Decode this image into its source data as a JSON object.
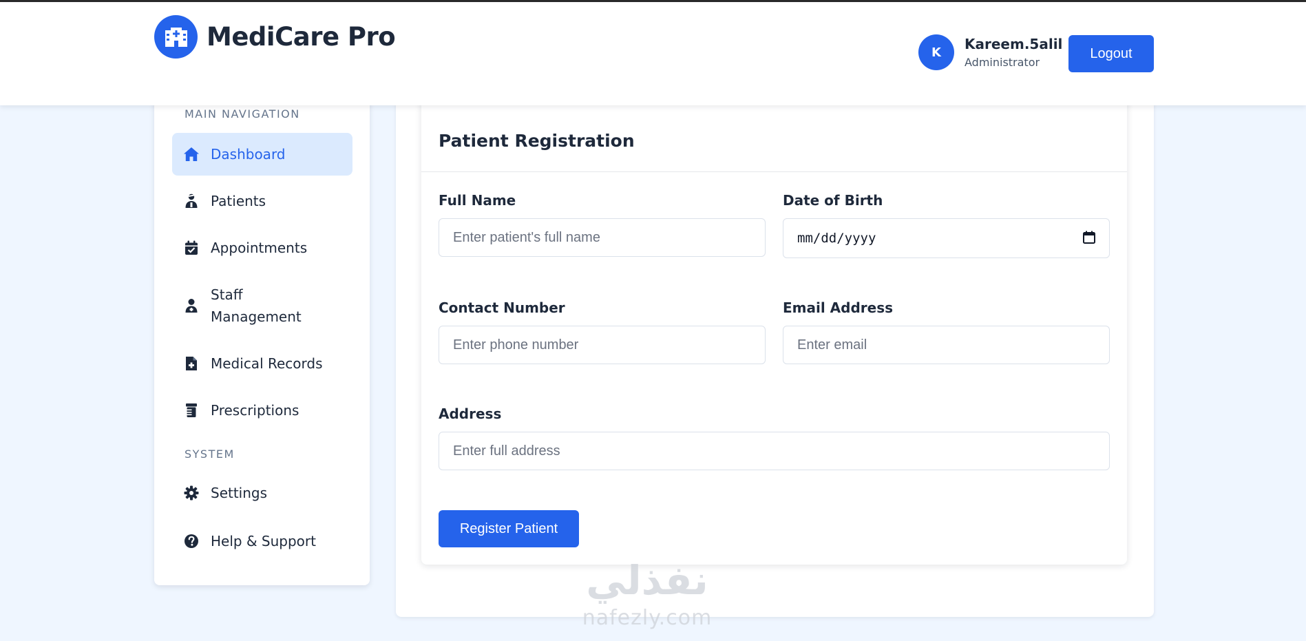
{
  "header": {
    "app_name": "MediCare Pro",
    "user": {
      "initial": "K",
      "name": "Kareem.5alil",
      "role": "Administrator"
    },
    "logout_label": "Logout"
  },
  "sidebar": {
    "sections": [
      {
        "title": "MAIN NAVIGATION"
      },
      {
        "title": "SYSTEM"
      }
    ],
    "items": [
      {
        "label": "Dashboard",
        "icon": "home-icon",
        "active": true
      },
      {
        "label": "Patients",
        "icon": "user-injured-icon"
      },
      {
        "label": "Appointments",
        "icon": "calendar-check-icon"
      },
      {
        "label": "Staff\nManagement",
        "icon": "user-doctor-icon"
      },
      {
        "label": "Medical Records",
        "icon": "file-medical-icon"
      },
      {
        "label": "Prescriptions",
        "icon": "prescription-bottle-icon"
      },
      {
        "label": "Settings",
        "icon": "gear-icon"
      },
      {
        "label": "Help & Support",
        "icon": "question-circle-icon"
      }
    ]
  },
  "form": {
    "title": "Patient Registration",
    "fields": {
      "full_name": {
        "label": "Full Name",
        "placeholder": "Enter patient's full name",
        "value": ""
      },
      "dob": {
        "label": "Date of Birth",
        "placeholder": "mm/dd/yyyy"
      },
      "contact": {
        "label": "Contact Number",
        "placeholder": "Enter phone number",
        "value": ""
      },
      "email": {
        "label": "Email Address",
        "placeholder": "Enter email",
        "value": ""
      },
      "address": {
        "label": "Address",
        "placeholder": "Enter full address",
        "value": ""
      }
    },
    "submit_label": "Register Patient"
  },
  "watermark": {
    "arabic": "نفذلي",
    "latin": "nafezly.com"
  },
  "colors": {
    "primary": "#2563eb",
    "active_bg": "#dbeafe",
    "page_bg": "#eff6ff"
  }
}
